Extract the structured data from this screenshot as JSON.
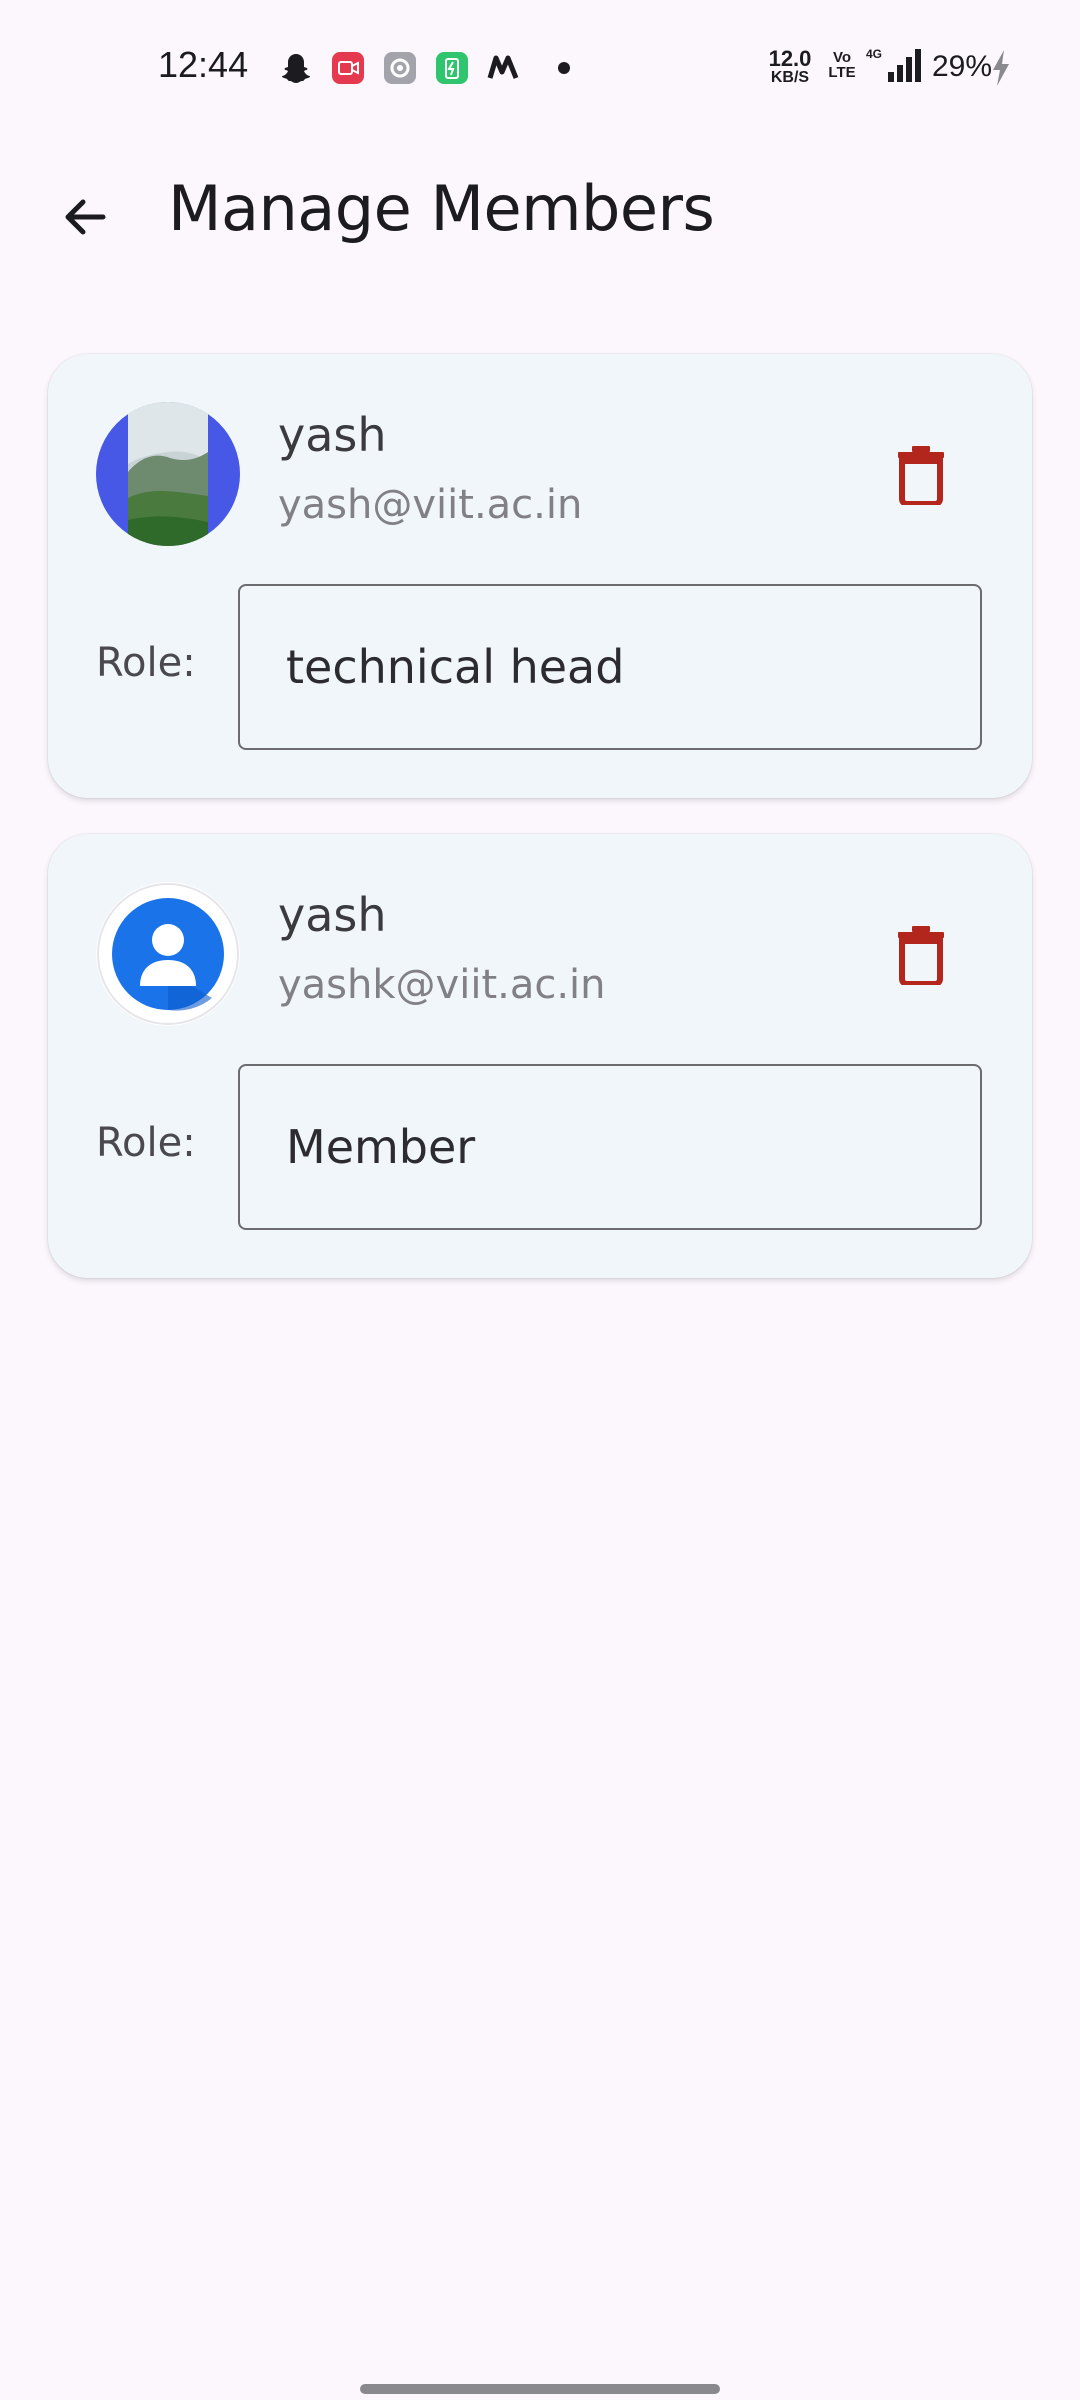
{
  "status_bar": {
    "time": "12:44",
    "net_speed_value": "12.0",
    "net_speed_unit": "KB/S",
    "volte_top": "Vo",
    "volte_bottom": "LTE",
    "network_type": "4G",
    "battery": "29%",
    "icons": [
      "snapchat-icon",
      "screen-record-icon",
      "settings-icon",
      "battery-saver-icon",
      "m-app-icon",
      "dot-icon",
      "signal-icon",
      "charging-bolt-icon"
    ]
  },
  "app_bar": {
    "title": "Manage Members"
  },
  "members": [
    {
      "name": "yash",
      "email": "yash@viit.ac.in",
      "role_label": "Role:",
      "role_value": "technical head",
      "avatar": "photo-avatar"
    },
    {
      "name": "yash",
      "email": "yashk@viit.ac.in",
      "role_label": "Role:",
      "role_value": "Member",
      "avatar": "default-person-avatar"
    }
  ],
  "colors": {
    "background": "#fcf6fd",
    "card": "#f1f6fb",
    "delete": "#b3261e",
    "avatar_blue": "#1a73e8"
  }
}
